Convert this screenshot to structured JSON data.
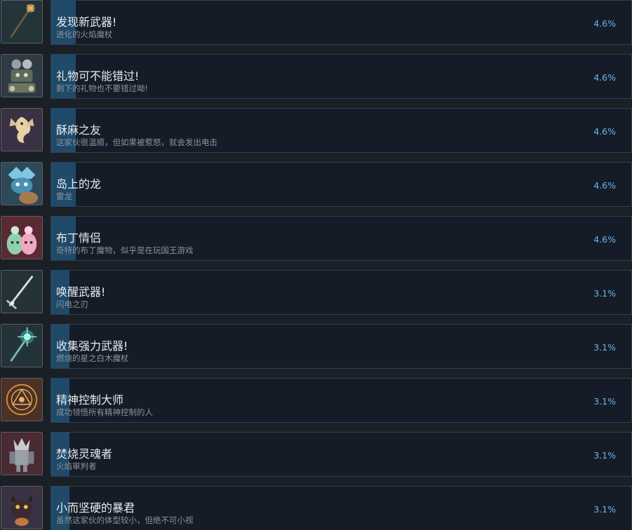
{
  "achievements": [
    {
      "title": "发现新武器!",
      "description": "进化的火焰魔杖",
      "percent": "4.6%",
      "percent_value": 4.6,
      "icon": "fire-staff-icon",
      "icon_bg": "#23343a"
    },
    {
      "title": "礼物可不能错过!",
      "description": "剩下的礼物也不要错过呦!",
      "percent": "4.6%",
      "percent_value": 4.6,
      "icon": "gift-robots-icon",
      "icon_bg": "#2e3a44"
    },
    {
      "title": "酥麻之友",
      "description": "这家伙很温顺，但如果被惹怒，就会发出电击",
      "percent": "4.6%",
      "percent_value": 4.6,
      "icon": "electric-dragon-icon",
      "icon_bg": "#3a3144"
    },
    {
      "title": "岛上的龙",
      "description": "雷龙",
      "percent": "4.6%",
      "percent_value": 4.6,
      "icon": "thunder-dragon-icon",
      "icon_bg": "#2d4a5a"
    },
    {
      "title": "布丁情侣",
      "description": "奇特的布丁魔物，似乎是在玩国王游戏",
      "percent": "4.6%",
      "percent_value": 4.6,
      "icon": "pudding-couple-icon",
      "icon_bg": "#5a2a33"
    },
    {
      "title": "唤醒武器!",
      "description": "闪电之刃",
      "percent": "3.1%",
      "percent_value": 3.1,
      "icon": "lightning-blade-icon",
      "icon_bg": "#253238"
    },
    {
      "title": "收集强力武器!",
      "description": "燃烧的星之白木魔杖",
      "percent": "3.1%",
      "percent_value": 3.1,
      "icon": "star-staff-icon",
      "icon_bg": "#243339"
    },
    {
      "title": "精神控制大师",
      "description": "成功领悟所有精神控制的人",
      "percent": "3.1%",
      "percent_value": 3.1,
      "icon": "magic-circle-icon",
      "icon_bg": "#4a3226"
    },
    {
      "title": "焚烧灵魂者",
      "description": "火焰审判者",
      "percent": "3.1%",
      "percent_value": 3.1,
      "icon": "soul-burner-icon",
      "icon_bg": "#4a2a33"
    },
    {
      "title": "小而坚硬的暴君",
      "description": "虽然这家伙的体型较小，但绝不可小视",
      "percent": "3.1%",
      "percent_value": 3.1,
      "icon": "small-tyrant-icon",
      "icon_bg": "#3a3344"
    }
  ],
  "colors": {
    "background": "#1b1f26",
    "card": "#151c27",
    "card_border": "#2c4456",
    "progress": "#1f4a6a",
    "percent_text": "#6cb3ea"
  }
}
